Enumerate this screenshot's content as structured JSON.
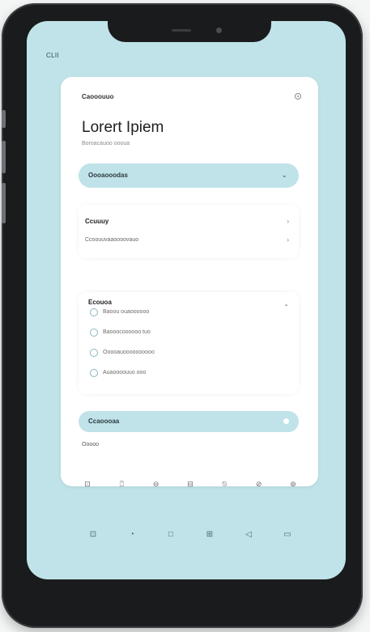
{
  "status": {
    "time": "CLII"
  },
  "card": {
    "small_title": "Caooouuo",
    "title": "Lorert Ipiem",
    "subtitle": "Boroacauoo oooua"
  },
  "dropdown": {
    "label": "Oooaooodas",
    "arrow": "⌄"
  },
  "section_one": {
    "heading": "Ccuuuy",
    "text": "Ccoouuvaaoooovauo"
  },
  "section_two": {
    "heading": "Ecouoa",
    "options": [
      {
        "label": "Baoou ouaoooooo"
      },
      {
        "label": "Baooocoooooo tuo"
      },
      {
        "label": "Ooooauoooooooooo"
      },
      {
        "label": "Auaoooouuo ooo"
      }
    ]
  },
  "bottom_pill": {
    "label": "Ccaoooaa"
  },
  "field": {
    "text": "Ooooo"
  },
  "toolbar": {
    "icons": [
      "⊡",
      "⍞",
      "⊖",
      "⊟",
      "⍉",
      "⊘",
      "⊚"
    ]
  },
  "navbar": {
    "icons": [
      "⊡",
      "◔",
      "□",
      "⊞",
      "◁",
      "▭"
    ]
  }
}
